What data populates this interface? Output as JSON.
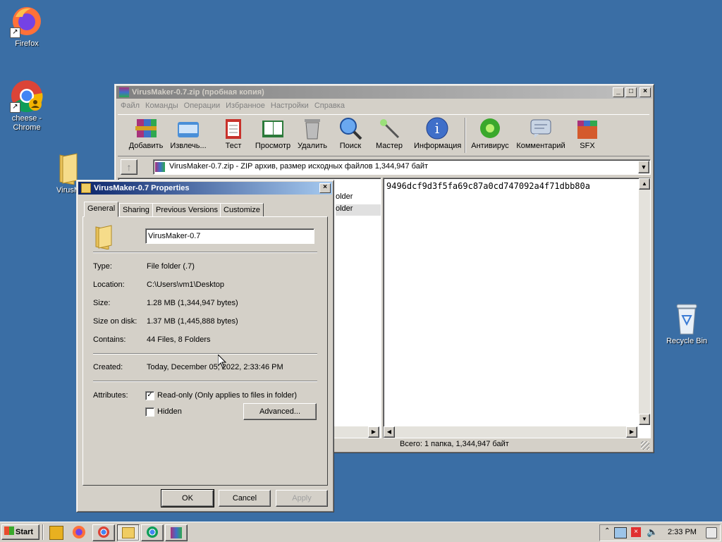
{
  "desktop": {
    "icons": [
      {
        "label": "Firefox"
      },
      {
        "label": "cheese -\nChrome"
      },
      {
        "label": "VirusM"
      },
      {
        "label": "Recycle Bin"
      }
    ]
  },
  "winrar": {
    "title": "VirusMaker-0.7.zip (пробная копия)",
    "menu": [
      "Файл",
      "Команды",
      "Операции",
      "Избранное",
      "Настройки",
      "Справка"
    ],
    "toolbar": [
      "Добавить",
      "Извлечь...",
      "Тест",
      "Просмотр",
      "Удалить",
      "Поиск",
      "Мастер",
      "Информация",
      "Антивирус",
      "Комментарий",
      "SFX"
    ],
    "path": "VirusMaker-0.7.zip - ZIP архив, размер исходных файлов 1,344,947 байт",
    "list_partial": [
      "older",
      "older"
    ],
    "comment": "9496dcf9d3f5fa69c87a0cd747092a4f71dbb80a",
    "status": "Всего: 1 папка, 1,344,947 байт"
  },
  "props": {
    "title": "VirusMaker-0.7 Properties",
    "tabs": [
      "General",
      "Sharing",
      "Previous Versions",
      "Customize"
    ],
    "name_value": "VirusMaker-0.7",
    "rows": {
      "type_label": "Type:",
      "type_value": "File folder (.7)",
      "location_label": "Location:",
      "location_value": "C:\\Users\\vm1\\Desktop",
      "size_label": "Size:",
      "size_value": "1.28 MB (1,344,947 bytes)",
      "sizeondisk_label": "Size on disk:",
      "sizeondisk_value": "1.37 MB (1,445,888 bytes)",
      "contains_label": "Contains:",
      "contains_value": "44 Files, 8 Folders",
      "created_label": "Created:",
      "created_value": "Today, December 05, 2022, 2:33:46 PM",
      "attributes_label": "Attributes:",
      "readonly_label": "Read-only (Only applies to files in folder)",
      "readonly_checked": true,
      "hidden_label": "Hidden",
      "hidden_checked": false,
      "advanced_label": "Advanced..."
    },
    "buttons": {
      "ok": "OK",
      "cancel": "Cancel",
      "apply": "Apply"
    }
  },
  "taskbar": {
    "start_label": "Start",
    "clock": "2:33 PM"
  }
}
